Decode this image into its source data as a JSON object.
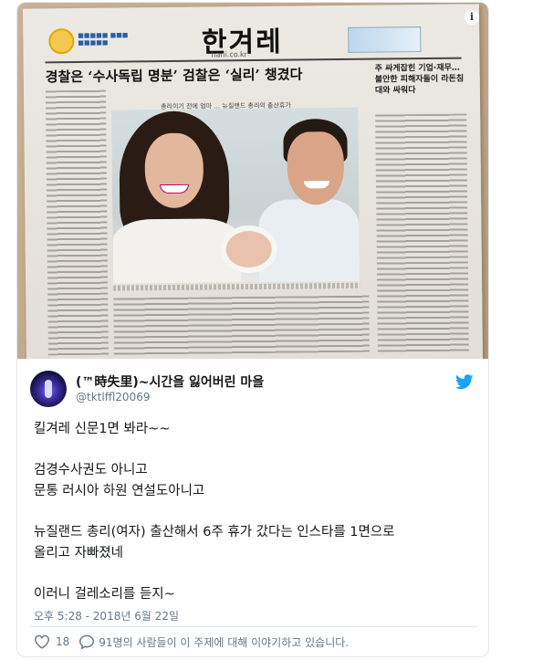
{
  "newspaper": {
    "masthead": "한겨레",
    "url": "hani.co.kr",
    "headline": "경찰은 ‘수사독립 명분’ 검찰은 ‘실리’ 챙겼다",
    "side_headline": "주 싸게잡힌 기업·재무… 불안한 피해자들이 라돈침대와 싸워다",
    "photo_caption": "총리이기 전에 엄마 … 뉴질랜드 총리의 출산휴가"
  },
  "tweet": {
    "display_name": "(™時失里)~시간을 잃어버린 마을",
    "handle": "@tktlffl20069",
    "lines": [
      "킬겨레 신문1면 봐라~~",
      "",
      "검경수사권도 아니고",
      "문통 러시아 하원 연설도아니고",
      "",
      " 뉴질랜드 총리(여자) 출산해서 6주 휴가 갔다는 인스타를 1면으로",
      "올리고 자빠졌네",
      "",
      "이러니 걸레소리를 듣지~"
    ],
    "timestamp": "오후 5:28 - 2018년 6월 22일",
    "likes": "18",
    "replies_text": "91명의 사람들이 이 주제에 대해 이야기하고 있습니다."
  },
  "icons": {
    "info": "info-icon",
    "brand": "twitter-bird-icon",
    "like": "heart-icon",
    "reply": "speech-bubble-icon"
  },
  "colors": {
    "twitter_blue": "#1da1f2",
    "meta_gray": "#657786",
    "text": "#14171a"
  }
}
